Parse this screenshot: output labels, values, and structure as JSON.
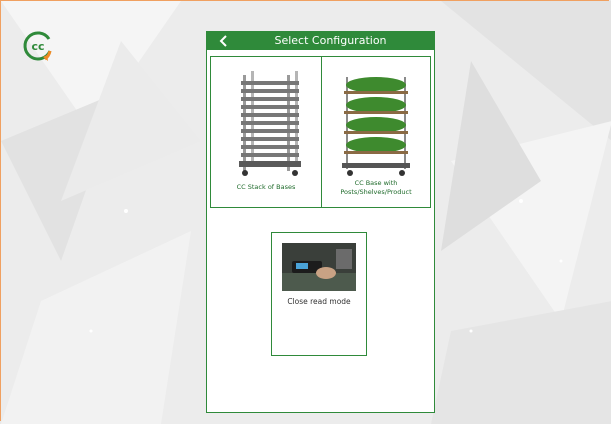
{
  "header": {
    "title": "Select Configuration"
  },
  "options": [
    {
      "label": "CC Stack of Bases",
      "icon": "cart-stack-of-bases-image"
    },
    {
      "label": "CC Base with Posts/Shelves/Product",
      "icon": "cart-with-plants-image"
    },
    {
      "label": "Close read mode",
      "icon": "handheld-scanner-photo"
    }
  ],
  "colors": {
    "brand_green": "#2f8a3a",
    "logo_orange": "#f08a24",
    "frame_border": "#f0a060"
  }
}
